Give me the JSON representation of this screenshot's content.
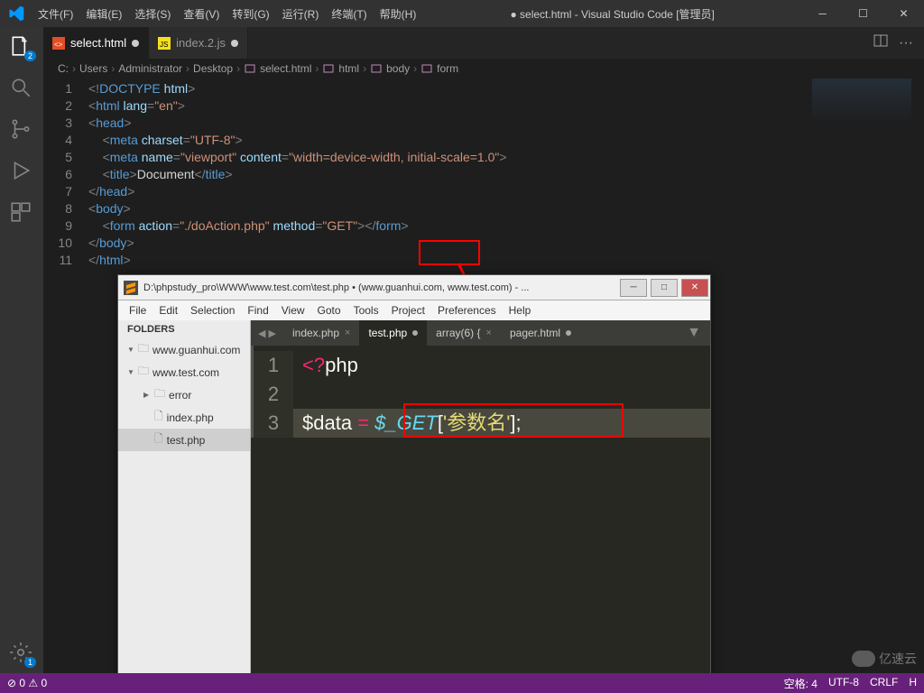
{
  "title": "● select.html - Visual Studio Code [管理员]",
  "menubar": [
    "文件(F)",
    "编辑(E)",
    "选择(S)",
    "查看(V)",
    "转到(G)",
    "运行(R)",
    "终端(T)",
    "帮助(H)"
  ],
  "activity_badges": {
    "explorer": "2",
    "gear": "1"
  },
  "tabs": [
    {
      "icon": "html",
      "label": "select.html",
      "active": true,
      "dirty": true
    },
    {
      "icon": "js",
      "label": "index.2.js",
      "active": false,
      "dirty": true
    }
  ],
  "breadcrumb": [
    "C:",
    "Users",
    "Administrator",
    "Desktop",
    "select.html",
    "html",
    "body",
    "form"
  ],
  "code_lines": [
    {
      "n": 1,
      "html": "<span class='t-punc'>&lt;!</span><span class='t-doctype'>DOCTYPE</span> <span class='t-attr'>html</span><span class='t-punc'>&gt;</span>"
    },
    {
      "n": 2,
      "html": "<span class='t-punc'>&lt;</span><span class='t-tag'>html</span> <span class='t-attr'>lang</span><span class='t-punc'>=</span><span class='t-str'>\"en\"</span><span class='t-punc'>&gt;</span>"
    },
    {
      "n": 3,
      "html": "<span class='t-punc'>&lt;</span><span class='t-tag'>head</span><span class='t-punc'>&gt;</span>"
    },
    {
      "n": 4,
      "html": "    <span class='t-punc'>&lt;</span><span class='t-tag'>meta</span> <span class='t-attr'>charset</span><span class='t-punc'>=</span><span class='t-str'>\"UTF-8\"</span><span class='t-punc'>&gt;</span>"
    },
    {
      "n": 5,
      "html": "    <span class='t-punc'>&lt;</span><span class='t-tag'>meta</span> <span class='t-attr'>name</span><span class='t-punc'>=</span><span class='t-str'>\"viewport\"</span> <span class='t-attr'>content</span><span class='t-punc'>=</span><span class='t-str'>\"width=device-width, initial-scale=1.0\"</span><span class='t-punc'>&gt;</span>"
    },
    {
      "n": 6,
      "html": "    <span class='t-punc'>&lt;</span><span class='t-tag'>title</span><span class='t-punc'>&gt;</span><span class='t-text'>Document</span><span class='t-punc'>&lt;/</span><span class='t-tag'>title</span><span class='t-punc'>&gt;</span>"
    },
    {
      "n": 7,
      "html": "<span class='t-punc'>&lt;/</span><span class='t-tag'>head</span><span class='t-punc'>&gt;</span>"
    },
    {
      "n": 8,
      "html": "<span class='t-punc'>&lt;</span><span class='t-tag'>body</span><span class='t-punc'>&gt;</span>"
    },
    {
      "n": 9,
      "html": "    <span class='t-punc'>&lt;</span><span class='t-tag'>form</span> <span class='t-attr'>action</span><span class='t-punc'>=</span><span class='t-str'>\"./doAction.php\"</span> <span class='t-attr'>method</span><span class='t-punc'>=</span><span class='t-str'>\"GET\"</span><span class='t-punc'>&gt;&lt;/</span><span class='t-tag'>form</span><span class='t-punc'>&gt;</span>"
    },
    {
      "n": 10,
      "html": "<span class='t-punc'>&lt;/</span><span class='t-tag'>body</span><span class='t-punc'>&gt;</span>"
    },
    {
      "n": 11,
      "html": "<span class='t-punc'>&lt;/</span><span class='t-tag'>html</span><span class='t-punc'>&gt;</span>"
    }
  ],
  "sublime": {
    "title": "D:\\phpstudy_pro\\WWW\\www.test.com\\test.php • (www.guanhui.com, www.test.com) - ...",
    "menu": [
      "File",
      "Edit",
      "Selection",
      "Find",
      "View",
      "Goto",
      "Tools",
      "Project",
      "Preferences",
      "Help"
    ],
    "folders_label": "FOLDERS",
    "tree": [
      {
        "depth": 0,
        "type": "folder",
        "open": true,
        "label": "www.guanhui.com"
      },
      {
        "depth": 0,
        "type": "folder",
        "open": true,
        "label": "www.test.com"
      },
      {
        "depth": 1,
        "type": "folder",
        "open": false,
        "label": "error"
      },
      {
        "depth": 1,
        "type": "file",
        "label": "index.php"
      },
      {
        "depth": 1,
        "type": "file",
        "label": "test.php",
        "sel": true
      }
    ],
    "tabs": [
      {
        "label": "index.php",
        "active": false,
        "close": true
      },
      {
        "label": "test.php",
        "active": true,
        "dirty": true
      },
      {
        "label": "array(6) {",
        "active": false,
        "close": true
      },
      {
        "label": "pager.html",
        "active": false,
        "dirty": true
      }
    ],
    "code": [
      {
        "n": 1,
        "html": "<span class='php-punc'>&lt;?</span><span class='php-open'>php</span>"
      },
      {
        "n": 2,
        "html": ""
      },
      {
        "n": 3,
        "html": "<span class='var'>$data</span> <span class='eq'>=</span> <span class='glob'>$_GET</span><span class='var'>[</span><span class='lit'>'参数名'</span><span class='var'>];</span>"
      }
    ]
  },
  "statusbar": {
    "left": [
      "⊘ 0 ⚠ 0"
    ],
    "right": [
      "空格: 4",
      "UTF-8",
      "CRLF",
      "H"
    ]
  },
  "watermark": "亿速云"
}
